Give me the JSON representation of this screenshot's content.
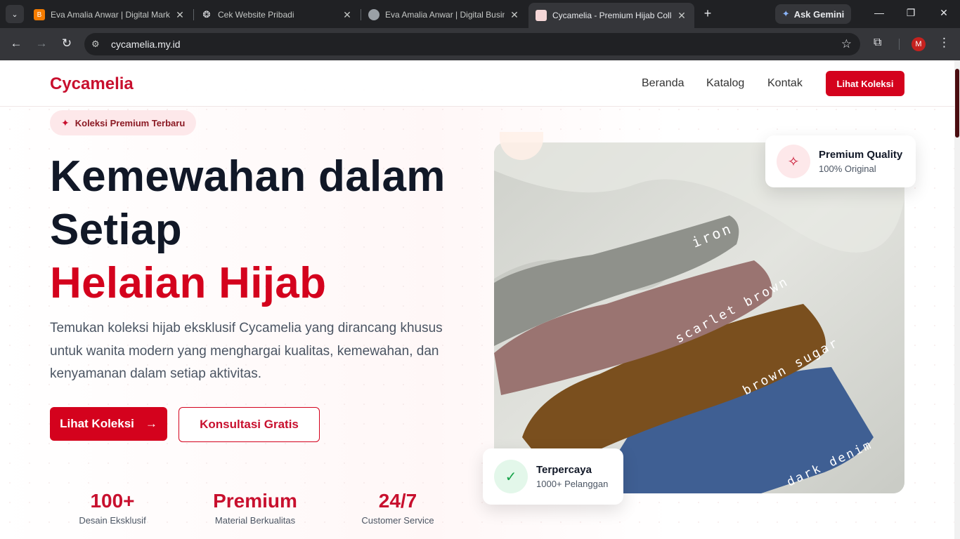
{
  "browser": {
    "tabs": [
      {
        "title": "Eva Amalia Anwar | Digital Mark",
        "favicon": "blogger-icon",
        "color": "#f57c00"
      },
      {
        "title": "Cek Website Pribadi",
        "favicon": "chatgpt-icon",
        "color": "#e8eaed"
      },
      {
        "title": "Eva Amalia Anwar | Digital Busin",
        "favicon": "avatar-icon",
        "color": "#9aa0a6"
      },
      {
        "title": "Cycamelia - Premium Hijab Colle",
        "favicon": "cycamelia-icon",
        "color": "#f5d7d7",
        "active": true
      }
    ],
    "ask_gemini": "Ask Gemini",
    "url": "cycamelia.my.id",
    "profile_initial": "M"
  },
  "site": {
    "logo": "Cycamelia",
    "nav": [
      "Beranda",
      "Katalog",
      "Kontak"
    ],
    "nav_cta": "Lihat Koleksi"
  },
  "hero": {
    "badge": "Koleksi Premium Terbaru",
    "title_line1": "Kemewahan dalam",
    "title_line2": "Setiap",
    "title_accent": "Helaian Hijab",
    "description": "Temukan koleksi hijab eksklusif Cycamelia yang dirancang khusus untuk wanita modern yang menghargai kualitas, kemewahan, dan kenyamanan dalam setiap aktivitas.",
    "btn_primary": "Lihat Koleksi",
    "btn_primary_arrow": "→",
    "btn_secondary": "Konsultasi Gratis",
    "stats": [
      {
        "value": "100+",
        "label": "Desain Eksklusif"
      },
      {
        "value": "Premium",
        "label": "Material Berkualitas"
      },
      {
        "value": "24/7",
        "label": "Customer Service"
      }
    ]
  },
  "image": {
    "labels": [
      "iron",
      "scarlet brown",
      "brown sugar",
      "dark denim"
    ],
    "colors": {
      "iron": "#8f918b",
      "scarlet_brown": "#9a7471",
      "brown_sugar": "#7a4f1e",
      "dark_denim": "#3f5f93"
    }
  },
  "cards": {
    "quality_title": "Premium Quality",
    "quality_sub": "100% Original",
    "trust_title": "Terpercaya",
    "trust_sub": "1000+ Pelanggan"
  },
  "colors": {
    "brand": "#d4021d",
    "brand_text": "#c8102e",
    "heading": "#111827"
  }
}
